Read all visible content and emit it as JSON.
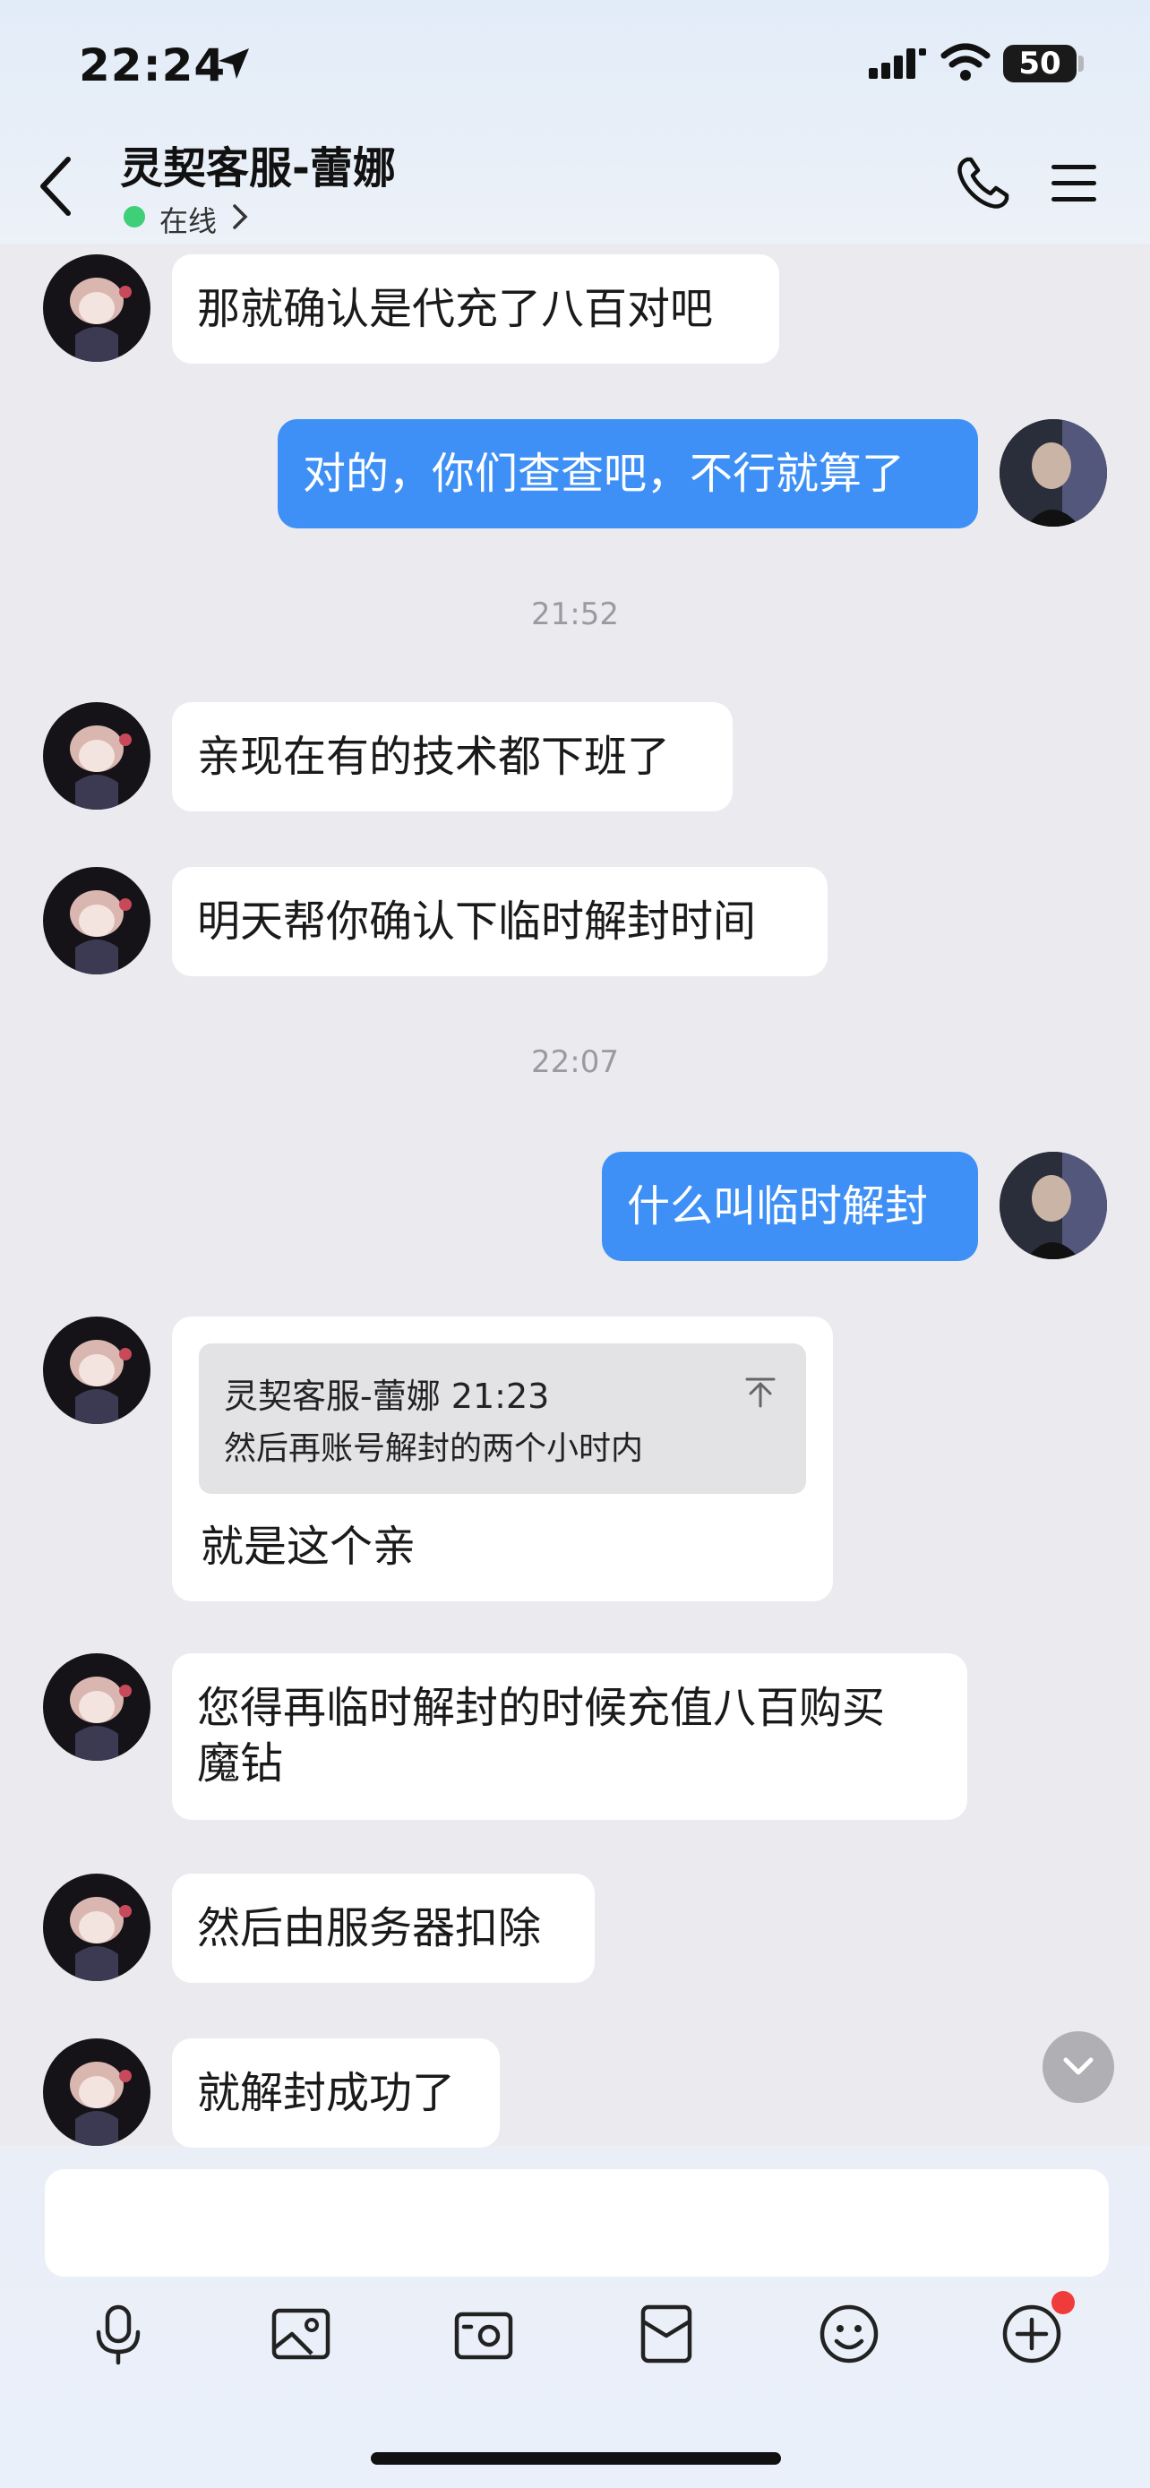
{
  "status_bar": {
    "time": "22:24",
    "battery": "50"
  },
  "header": {
    "title": "灵契客服-蕾娜",
    "status": "在线",
    "status_color": "#3fcf78"
  },
  "messages": [
    {
      "from": "agent",
      "text": "那就确认是代充了八百对吧"
    },
    {
      "from": "me",
      "text": "对的，你们查查吧，不行就算了"
    },
    {
      "type": "timestamp",
      "text": "21:52"
    },
    {
      "from": "agent",
      "text": "亲现在有的技术都下班了"
    },
    {
      "from": "agent",
      "text": "明天帮你确认下临时解封时间"
    },
    {
      "type": "timestamp",
      "text": "22:07"
    },
    {
      "from": "me",
      "text": "什么叫临时解封"
    },
    {
      "from": "agent",
      "quote": {
        "header": "灵契客服-蕾娜 21:23",
        "text": "然后再账号解封的两个小时内"
      },
      "text": "就是这个亲"
    },
    {
      "from": "agent",
      "lines": [
        "您得再临时解封的时候充值八百购买",
        "魔钻"
      ]
    },
    {
      "from": "agent",
      "text": "然后由服务器扣除"
    },
    {
      "from": "agent",
      "text": "就解封成功了"
    }
  ],
  "composer": {
    "placeholder": "",
    "toolbar": [
      "microphone-icon",
      "image-icon",
      "camera-icon",
      "red-packet-icon",
      "emoji-icon",
      "plus-icon"
    ]
  },
  "colors": {
    "outgoing_bubble": "#3e90f6",
    "incoming_bubble": "#ffffff",
    "background": "#ebebef",
    "badge": "#f03b3b"
  }
}
